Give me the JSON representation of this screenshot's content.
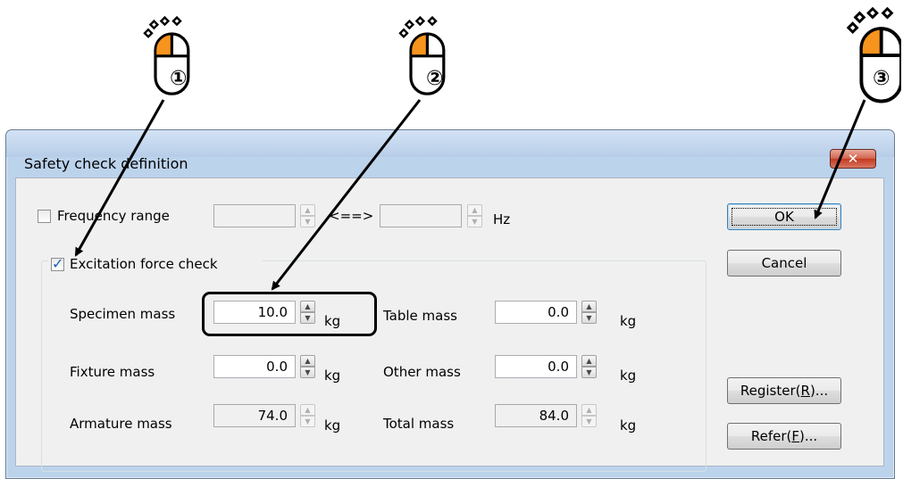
{
  "dialog": {
    "title": "Safety check definition",
    "close_glyph": "✕",
    "frequency": {
      "checkbox_label": "Frequency range",
      "checked": false,
      "from_value": "",
      "to_value": "",
      "separator": "<==>",
      "unit": "Hz"
    },
    "excitation": {
      "checkbox_label": "Excitation force check",
      "checked": true,
      "checkmark": "✓",
      "specimen_mass": {
        "label": "Specimen mass",
        "value": "10.0",
        "unit": "kg"
      },
      "fixture_mass": {
        "label": "Fixture  mass",
        "value": "0.0",
        "unit": "kg"
      },
      "armature_mass": {
        "label": "Armature mass",
        "value": "74.0",
        "unit": "kg"
      },
      "table_mass": {
        "label": "Table mass",
        "value": "0.0",
        "unit": "kg"
      },
      "other_mass": {
        "label": "Other mass",
        "value": "0.0",
        "unit": "kg"
      },
      "total_mass": {
        "label": "Total mass",
        "value": "84.0",
        "unit": "kg"
      }
    },
    "buttons": {
      "ok": "OK",
      "cancel": "Cancel",
      "register_main": "Register(",
      "register_key": "R",
      "register_tail": ")...",
      "refer_main": "Refer(",
      "refer_key": "F",
      "refer_tail": ")..."
    }
  },
  "callouts": {
    "step1": "①",
    "step2": "②",
    "step3": "③"
  },
  "colors": {
    "mouse_button": "#f7941d",
    "dialog_frame": "#bcd3ec",
    "client_bg": "#f0f0f0",
    "close_button": "#c43a1f"
  }
}
